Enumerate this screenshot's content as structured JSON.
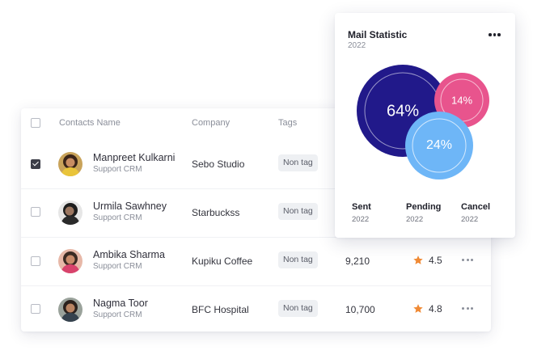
{
  "contacts_table": {
    "columns": {
      "name": "Contacts Name",
      "company": "Company",
      "tags": "Tags"
    },
    "rows": [
      {
        "checked": true,
        "name": "Manpreet Kulkarni",
        "role": "Support CRM",
        "company": "Sebo Studio",
        "tag": "Non tag",
        "count": "",
        "rating": ""
      },
      {
        "checked": false,
        "name": "Urmila Sawhney",
        "role": "Support CRM",
        "company": "Starbuckss",
        "tag": "Non tag",
        "count": "",
        "rating": ""
      },
      {
        "checked": false,
        "name": "Ambika Sharma",
        "role": "Support CRM",
        "company": "Kupiku Coffee",
        "tag": "Non tag",
        "count": "9,210",
        "rating": "4.5"
      },
      {
        "checked": false,
        "name": "Nagma Toor",
        "role": "Support CRM",
        "company": "BFC Hospital",
        "tag": "Non tag",
        "count": "10,700",
        "rating": "4.8"
      }
    ],
    "icons": {
      "rating": "star-icon",
      "row_menu": "more-horizontal-icon"
    }
  },
  "mail_statistic": {
    "title": "Mail Statistic",
    "year": "2022",
    "menu_icon": "more-horizontal-icon",
    "colors": {
      "sent": "#21198a",
      "pending": "#e8548d",
      "cancel": "#6eb6f7"
    },
    "bubbles": [
      {
        "key": "sent",
        "label": "64%",
        "value": 64
      },
      {
        "key": "pending",
        "label": "14%",
        "value": 14
      },
      {
        "key": "cancel",
        "label": "24%",
        "value": 24
      }
    ],
    "legend": [
      {
        "label": "Sent",
        "year": "2022"
      },
      {
        "label": "Pending",
        "year": "2022"
      },
      {
        "label": "Cancel",
        "year": "2022"
      }
    ]
  },
  "accent": {
    "star": "#f08a35"
  }
}
